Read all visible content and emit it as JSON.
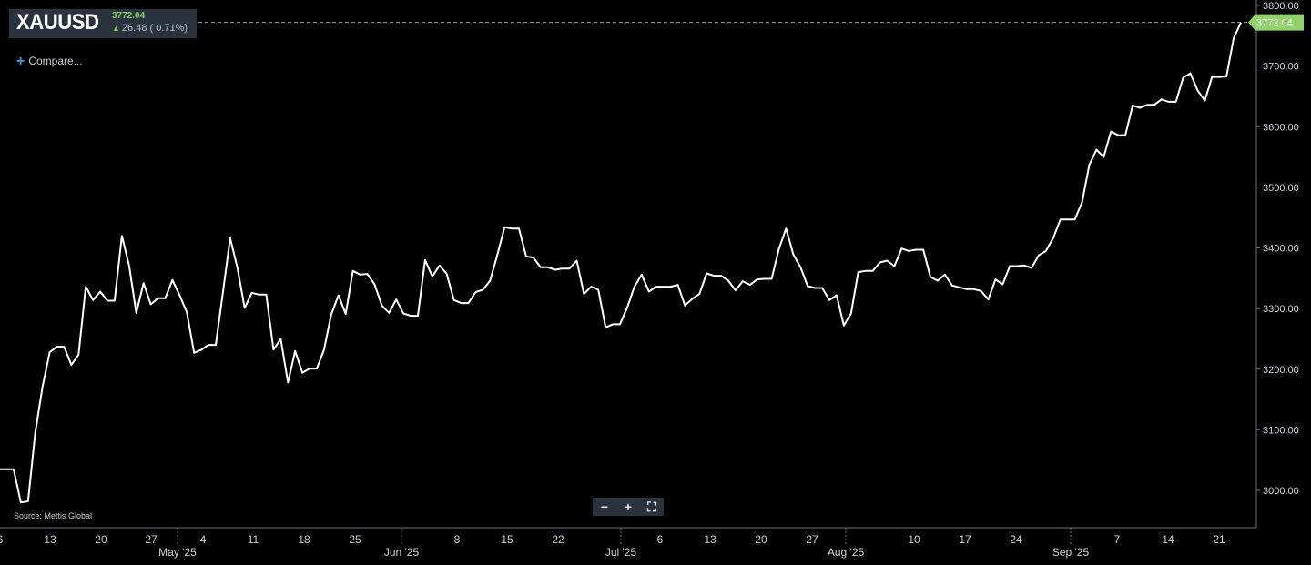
{
  "header": {
    "symbol": "XAUUSD",
    "price": "3772.04",
    "change_arrow": "up-arrow-icon",
    "change": "26.48 ( 0.71%)"
  },
  "compare_label": "Compare...",
  "source_label": "Source: Mettis Global",
  "price_tag": "3772.04",
  "colors": {
    "line": "#ffffff",
    "background": "#000000",
    "positive": "#7fd35a",
    "tag": "#8fd36a",
    "panel": "#2a323d"
  },
  "zoom_controls": [
    "zoom-out-icon",
    "zoom-in-icon",
    "fullscreen-icon"
  ],
  "chart_data": {
    "type": "line",
    "title": "",
    "xlabel": "",
    "ylabel": "",
    "ylim": [
      2950,
      3800
    ],
    "y_ticks": [
      "3800.00",
      "3700.00",
      "3600.00",
      "3500.00",
      "3400.00",
      "3300.00",
      "3200.00",
      "3100.00",
      "3000.00"
    ],
    "x_day_ticks": [
      "6",
      "13",
      "20",
      "27",
      "4",
      "11",
      "18",
      "25",
      "8",
      "15",
      "22",
      "6",
      "13",
      "20",
      "27",
      "10",
      "17",
      "24",
      "7",
      "14",
      "21"
    ],
    "x_month_ticks": [
      "May '25",
      "Jun '25",
      "Jul '25",
      "Aug '25",
      "Sep '25"
    ],
    "grid": false,
    "series": [
      {
        "name": "XAUUSD",
        "values": [
          3035,
          3035,
          2980,
          2982,
          3095,
          3170,
          3228,
          3237,
          3237,
          3207,
          3224,
          3336,
          3314,
          3328,
          3313,
          3313,
          3420,
          3371,
          3293,
          3342,
          3307,
          3317,
          3317,
          3347,
          3322,
          3294,
          3227,
          3232,
          3240,
          3240,
          3327,
          3416,
          3367,
          3301,
          3326,
          3323,
          3323,
          3232,
          3250,
          3178,
          3230,
          3194,
          3201,
          3201,
          3232,
          3290,
          3322,
          3291,
          3362,
          3356,
          3357,
          3340,
          3305,
          3293,
          3315,
          3292,
          3288,
          3288,
          3380,
          3353,
          3371,
          3357,
          3314,
          3309,
          3309,
          3327,
          3331,
          3346,
          3388,
          3434,
          3432,
          3432,
          3386,
          3384,
          3368,
          3368,
          3364,
          3366,
          3366,
          3379,
          3324,
          3336,
          3331,
          3269,
          3274,
          3274,
          3302,
          3336,
          3356,
          3328,
          3336,
          3336,
          3336,
          3339,
          3305,
          3316,
          3324,
          3358,
          3354,
          3354,
          3346,
          3330,
          3345,
          3339,
          3348,
          3349,
          3349,
          3398,
          3432,
          3389,
          3368,
          3337,
          3334,
          3334,
          3314,
          3322,
          3272,
          3292,
          3360,
          3362,
          3362,
          3376,
          3379,
          3370,
          3399,
          3395,
          3397,
          3397,
          3352,
          3346,
          3356,
          3338,
          3335,
          3332,
          3332,
          3329,
          3315,
          3348,
          3340,
          3370,
          3370,
          3371,
          3367,
          3388,
          3395,
          3416,
          3447,
          3447,
          3447,
          3475,
          3537,
          3562,
          3550,
          3592,
          3586,
          3586,
          3635,
          3631,
          3636,
          3636,
          3645,
          3641,
          3641,
          3681,
          3688,
          3660,
          3643,
          3682,
          3682,
          3683,
          3746,
          3772
        ]
      }
    ]
  }
}
